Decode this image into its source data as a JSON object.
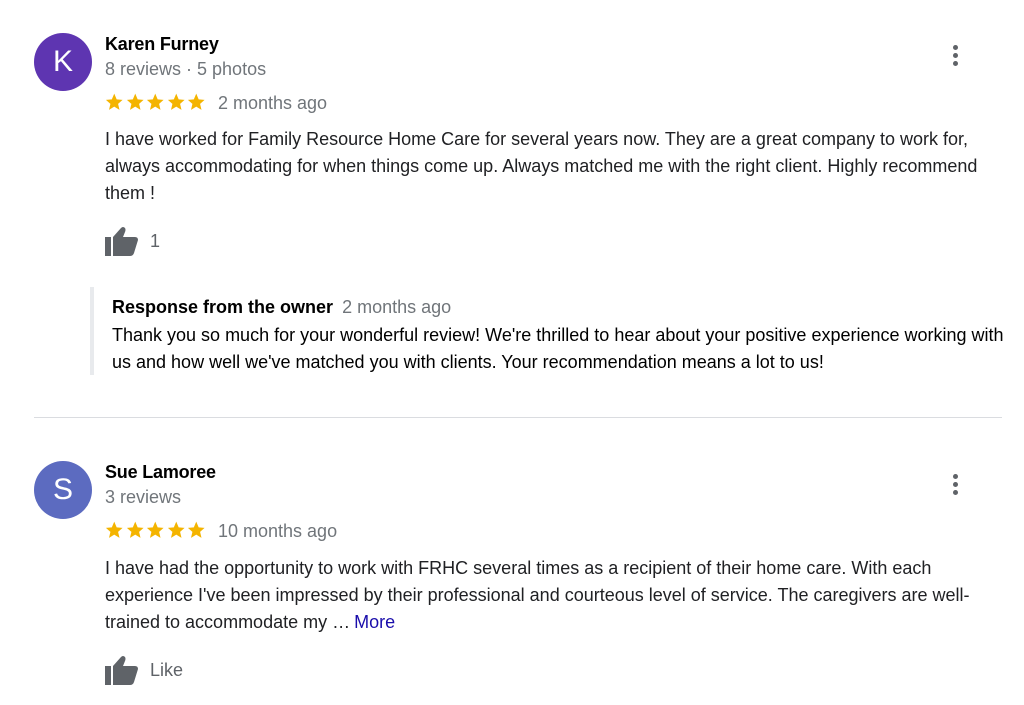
{
  "colors": {
    "star": "#f4b400",
    "avatar_k": "#5e35b1",
    "avatar_s": "#5c6bc0",
    "link": "#1a0dab"
  },
  "reviews": [
    {
      "avatar_letter": "K",
      "name": "Karen Furney",
      "meta": "8 reviews · 5 photos",
      "rating": 5,
      "time": "2 months ago",
      "text": "I have worked for Family Resource Home Care for several years now. They are a great company to work for, always accommodating for when things come up. Always matched me with the right client. Highly recommend them !",
      "like_label": "1",
      "owner_response": {
        "title": "Response from the owner",
        "time": "2 months ago",
        "text": "Thank you so much for your wonderful review! We're thrilled to hear about your positive experience working with us and how well we've matched you with clients. Your recommendation means a lot to us!"
      }
    },
    {
      "avatar_letter": "S",
      "name": "Sue Lamoree",
      "meta": "3 reviews",
      "rating": 5,
      "time": "10 months ago",
      "text": "I have had the opportunity to work with FRHC several times as a recipient of their home care. With each experience I've been impressed by their professional and courteous level of service. The caregivers are well-trained to accommodate my …",
      "more_label": "More",
      "like_label": "Like"
    }
  ]
}
